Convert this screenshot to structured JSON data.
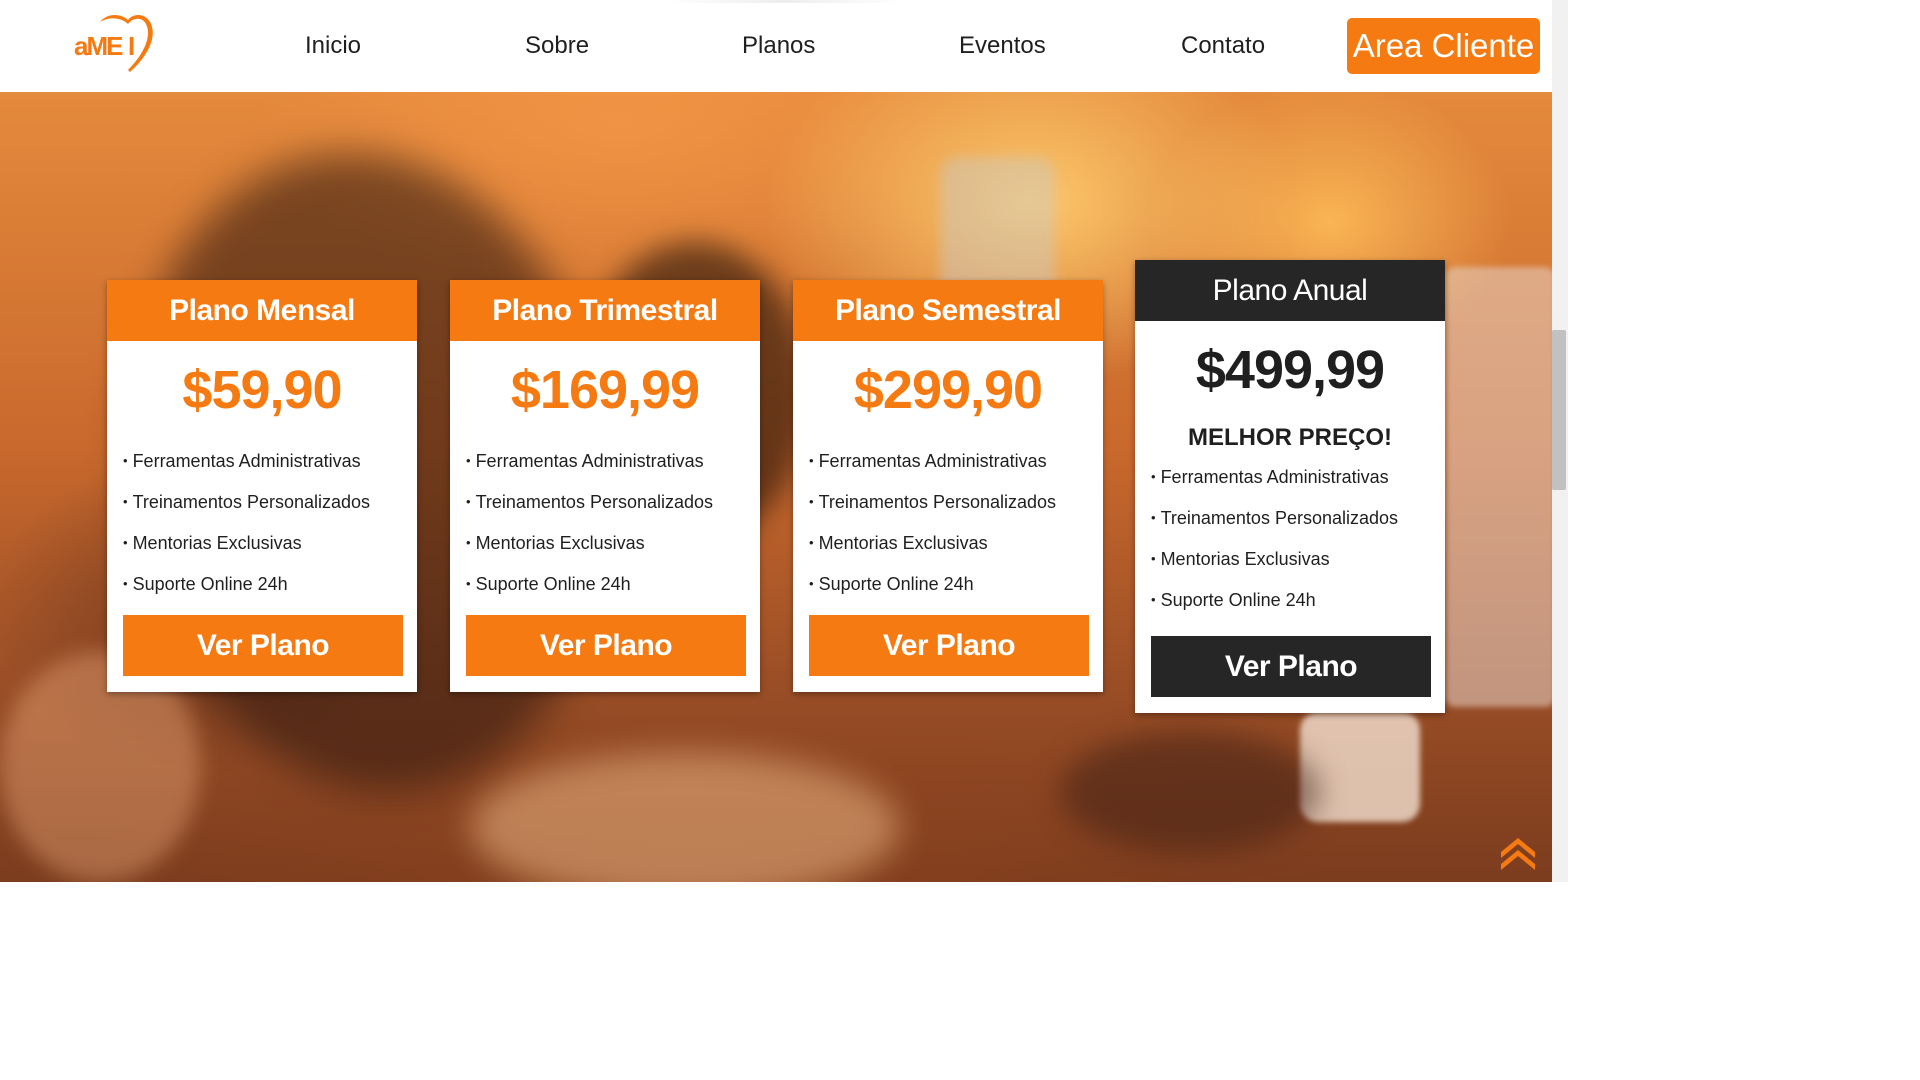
{
  "brand": {
    "logo_text": "AMEI",
    "accent_color": "#f57a12",
    "dark_color": "#262626"
  },
  "nav": {
    "items": [
      {
        "label": "Inicio"
      },
      {
        "label": "Sobre"
      },
      {
        "label": "Planos"
      },
      {
        "label": "Eventos"
      },
      {
        "label": "Contato"
      }
    ],
    "cta_label": "Area Cliente"
  },
  "plans": [
    {
      "name": "Plano Mensal",
      "price": "$59,90",
      "features": [
        "Ferramentas Administrativas",
        "Treinamentos Personalizados",
        "Mentorias Exclusivas",
        "Suporte Online 24h"
      ],
      "button": "Ver Plano"
    },
    {
      "name": "Plano Trimestral",
      "price": "$169,99",
      "features": [
        "Ferramentas Administrativas",
        "Treinamentos Personalizados",
        "Mentorias Exclusivas",
        "Suporte Online 24h"
      ],
      "button": "Ver Plano"
    },
    {
      "name": "Plano Semestral",
      "price": "$299,90",
      "features": [
        "Ferramentas Administrativas",
        "Treinamentos Personalizados",
        "Mentorias Exclusivas",
        "Suporte Online 24h"
      ],
      "button": "Ver Plano"
    },
    {
      "name": "Plano Anual",
      "price": "$499,99",
      "badge": "MELHOR PREÇO!",
      "features": [
        "Ferramentas Administrativas",
        "Treinamentos Personalizados",
        "Mentorias Exclusivas",
        "Suporte Online 24h"
      ],
      "button": "Ver Plano"
    }
  ],
  "icons": {
    "scroll_top": "double-chevron-up-icon"
  }
}
